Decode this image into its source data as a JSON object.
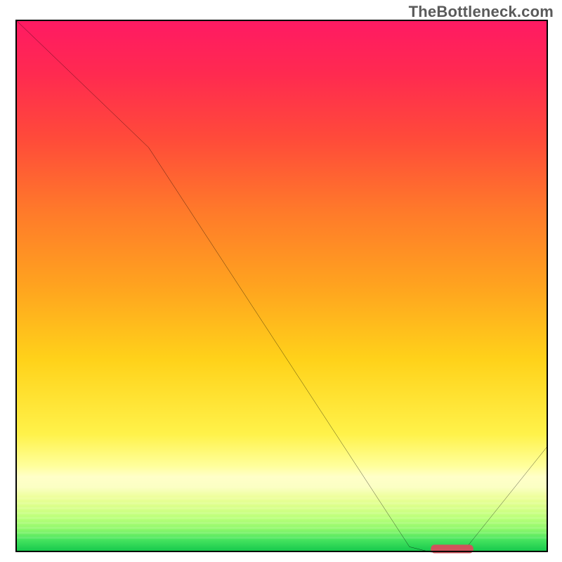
{
  "watermark": "TheBottleneck.com",
  "chart_data": {
    "type": "line",
    "title": "",
    "xlabel": "",
    "ylabel": "",
    "xlim": [
      0,
      100
    ],
    "ylim": [
      0,
      100
    ],
    "series": [
      {
        "name": "bottleneck-curve",
        "x": [
          0,
          25,
          74,
          78,
          84,
          100
        ],
        "values": [
          100,
          76,
          1,
          0,
          0,
          20
        ]
      }
    ],
    "marker": {
      "x_start": 78,
      "x_end": 86,
      "y": 0
    },
    "gradient_stops": [
      {
        "pct": 0,
        "color": "#ff1a63"
      },
      {
        "pct": 50,
        "color": "#ffa31f"
      },
      {
        "pct": 80,
        "color": "#ffff9c"
      },
      {
        "pct": 100,
        "color": "#18c94d"
      }
    ]
  }
}
